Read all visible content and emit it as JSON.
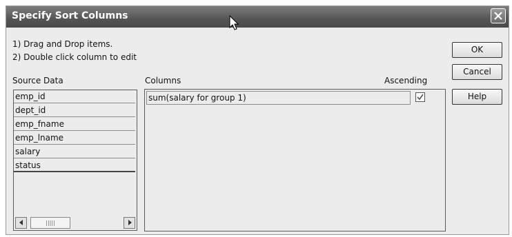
{
  "dialog": {
    "title": "Specify Sort Columns",
    "instructions": [
      "1) Drag and Drop items.",
      "2) Double click column to edit"
    ]
  },
  "source": {
    "label": "Source Data",
    "items": [
      "emp_id",
      "dept_id",
      "emp_fname",
      "emp_lname",
      "salary",
      "status"
    ]
  },
  "columns": {
    "label": "Columns",
    "ascending_label": "Ascending",
    "rows": [
      {
        "expr": "sum(salary for group 1)",
        "ascending": true
      }
    ]
  },
  "buttons": {
    "ok": "OK",
    "cancel": "Cancel",
    "help": "Help"
  },
  "icons": {
    "close": "close-icon",
    "cursor": "mouse-pointer-icon",
    "scroll_left": "scroll-left-icon",
    "scroll_right": "scroll-right-icon",
    "check": "checkmark-icon"
  },
  "colors": {
    "titlebar": "#555555",
    "title_text": "#ffffff",
    "dialog_bg": "#ececec"
  }
}
